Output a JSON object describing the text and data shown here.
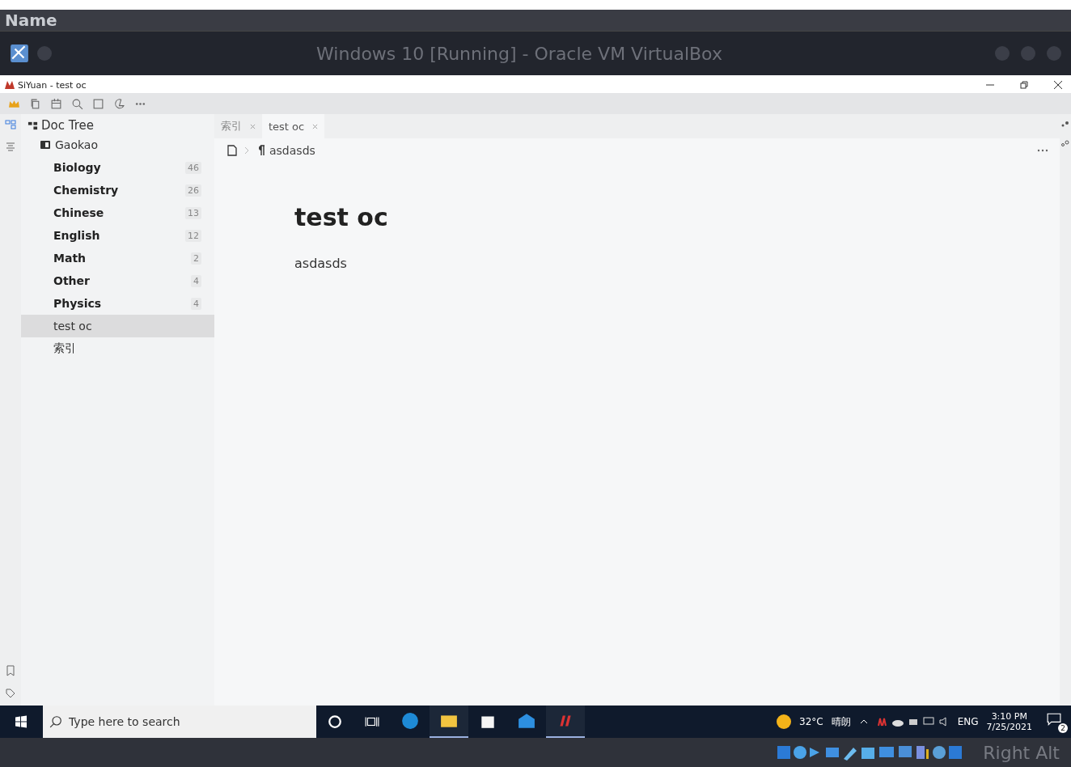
{
  "outer_header": {
    "title": "Name"
  },
  "vm_window": {
    "title": "Windows 10 [Running] - Oracle VM VirtualBox"
  },
  "app_window": {
    "title": "SiYuan - test oc"
  },
  "sidebar": {
    "title": "Doc Tree",
    "notebook": "Gaokao",
    "items": [
      {
        "label": "Biology",
        "count": "46",
        "has_children": true,
        "selected": false
      },
      {
        "label": "Chemistry",
        "count": "26",
        "has_children": true,
        "selected": false
      },
      {
        "label": "Chinese",
        "count": "13",
        "has_children": true,
        "selected": false
      },
      {
        "label": "English",
        "count": "12",
        "has_children": true,
        "selected": false
      },
      {
        "label": "Math",
        "count": "2",
        "has_children": true,
        "selected": false
      },
      {
        "label": "Other",
        "count": "4",
        "has_children": true,
        "selected": false
      },
      {
        "label": "Physics",
        "count": "4",
        "has_children": true,
        "selected": false
      },
      {
        "label": "test oc",
        "has_children": false,
        "selected": true
      },
      {
        "label": "索引",
        "has_children": false,
        "selected": false
      }
    ]
  },
  "tabs": [
    {
      "label": "索引",
      "selected": false
    },
    {
      "label": "test oc",
      "selected": true
    }
  ],
  "breadcrumb": {
    "block": "asdasds"
  },
  "document": {
    "title": "test oc",
    "paragraph": "asdasds"
  },
  "taskbar": {
    "search_placeholder": "Type here to search",
    "apps": [
      {
        "kind": "edge",
        "active": false
      },
      {
        "kind": "explorer",
        "active": true
      },
      {
        "kind": "store",
        "active": false
      },
      {
        "kind": "mail",
        "active": false
      },
      {
        "kind": "siyuan",
        "active": true
      }
    ],
    "weather": "32°C",
    "weather_text": "晴朗",
    "language": "ENG",
    "time": "3:10 PM",
    "date": "7/25/2021",
    "notifications": "2"
  },
  "vm_status": {
    "host_key": "Right Alt"
  }
}
